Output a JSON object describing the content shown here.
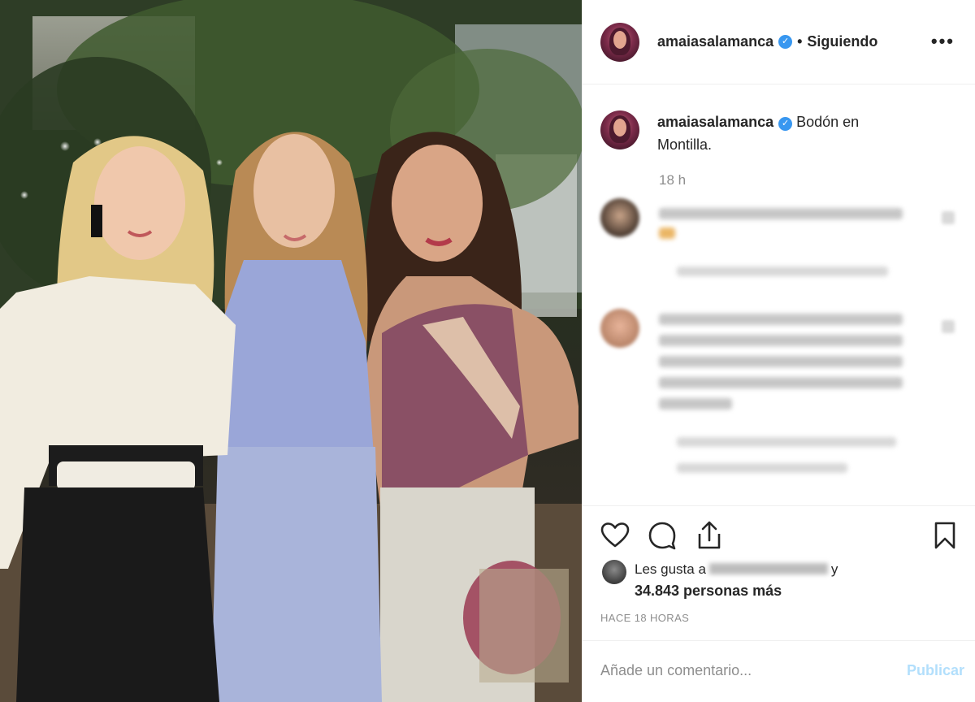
{
  "post": {
    "username": "amaiasalamanca",
    "verified_mark": "✓",
    "separator": "•",
    "following_label": "Siguiendo",
    "more_label": "•••",
    "caption": "Bodón en Montilla.",
    "caption_time": "18 h"
  },
  "likes": {
    "prefix": "Les gusta a",
    "suffix": "y",
    "count_text": "34.843 personas más"
  },
  "timestamp": "HACE 18 HORAS",
  "comment_box": {
    "placeholder": "Añade un comentario...",
    "publish_label": "Publicar"
  },
  "icons": {
    "like": "heart-icon",
    "comment": "comment-bubble-icon",
    "share": "share-icon",
    "save": "bookmark-icon",
    "verified": "verified-badge-icon"
  },
  "colors": {
    "verified_blue": "#3897f0",
    "publish_disabled": "#b2dffc",
    "muted_text": "#8e8e8e",
    "text": "#262626"
  }
}
